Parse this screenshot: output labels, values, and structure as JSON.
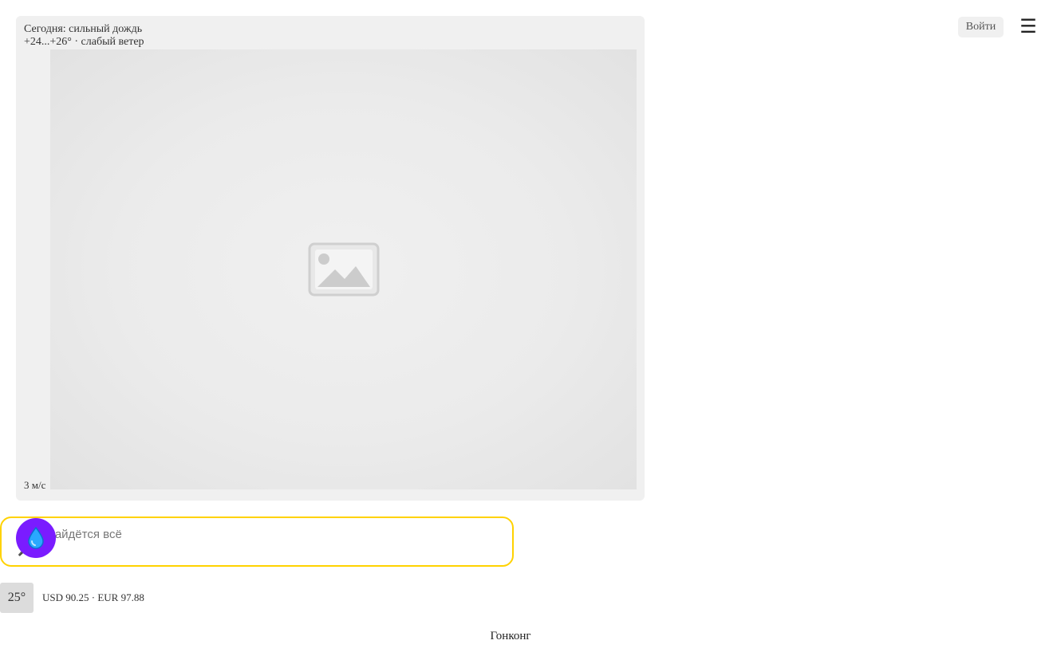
{
  "header": {
    "login_label": "Войти",
    "menu_icon": "hamburger-menu-icon",
    "menu_glyph": "☰"
  },
  "weather": {
    "summary": "Сегодня: сильный дождь",
    "details": "+24...+26° · слабый ветер",
    "wind": "3 м/с",
    "image_icon": "image-placeholder-icon"
  },
  "search": {
    "placeholder": "Найдётся всё",
    "voice_icon": "microphone-icon",
    "camera_icon": "camera-icon",
    "voice_glyph": "🎤",
    "camera_glyph": "📷",
    "alice_icon": "water-drop-icon",
    "alice_glyph": "💧",
    "border_color": "#ffd200",
    "alice_color": "#7a1cff"
  },
  "informers": {
    "temperature": "25°",
    "currency": "USD 90.25 · EUR 97.88",
    "region": "Гонконг"
  }
}
